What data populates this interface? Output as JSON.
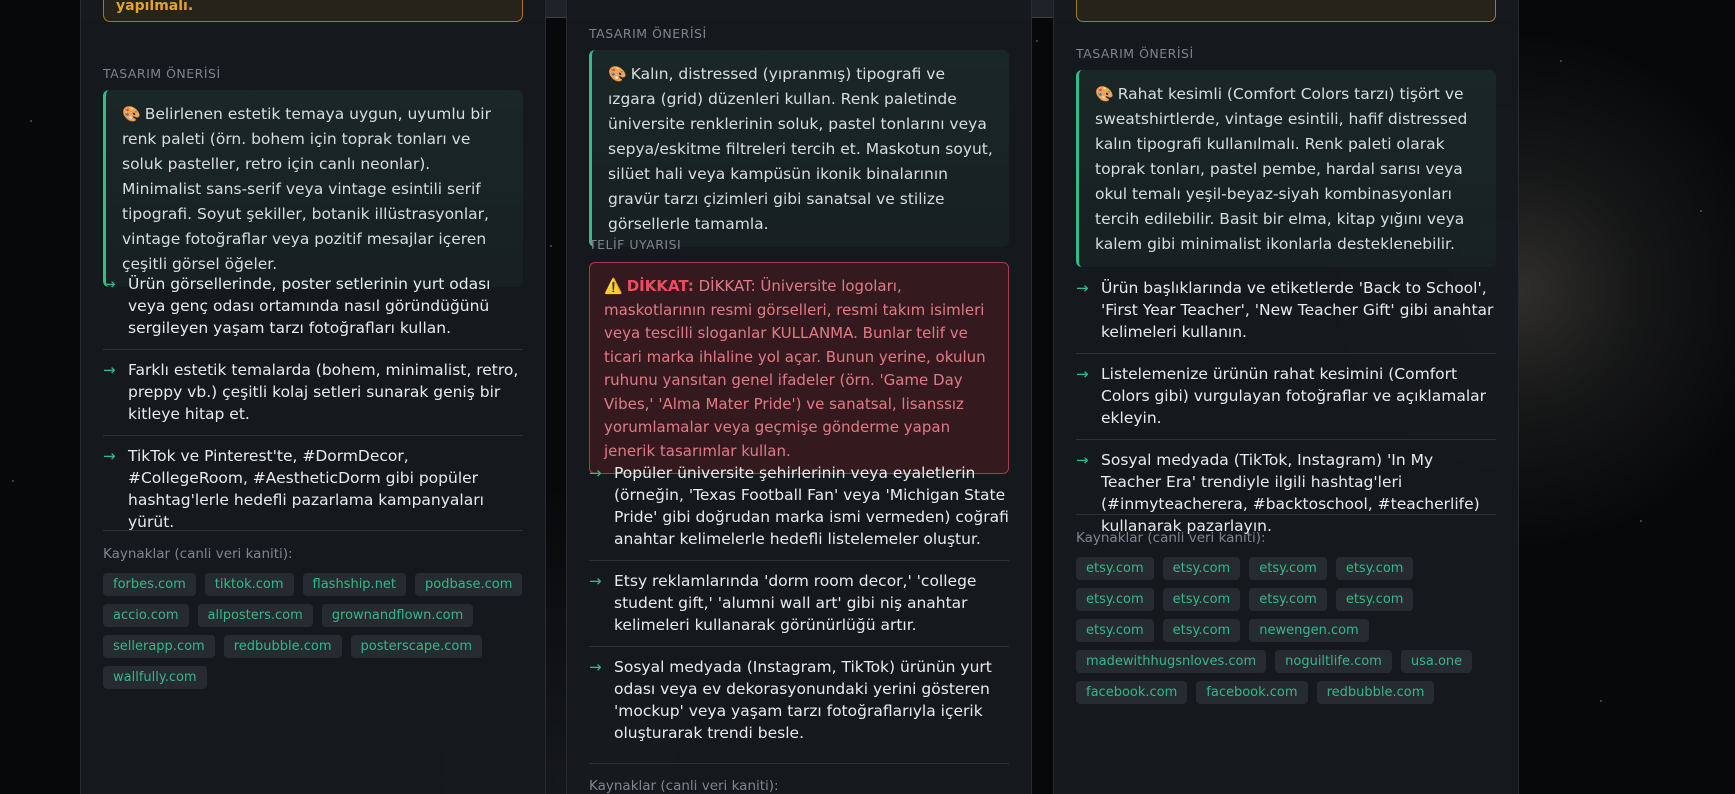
{
  "columns": [
    {
      "warning_tail": "yapılmalı.",
      "design_label": "TASARIM ÖNERİSİ",
      "design_emoji": "🎨",
      "design_text": "Belirlenen estetik temaya uygun, uyumlu bir renk paleti (örn. bohem için toprak tonları ve soluk pasteller, retro için canlı neonlar). Minimalist sans-serif veya vintage esintili serif tipografi. Soyut şekiller, botanik illüstrasyonlar, vintage fotoğraflar veya pozitif mesajlar içeren çeşitli görsel öğeler.",
      "bullets": [
        "Ürün görsellerinde, poster setlerinin yurt odası veya genç odası ortamında nasıl göründüğünü sergileyen yaşam tarzı fotoğrafları kullan.",
        "Farklı estetik temalarda (bohem, minimalist, retro, preppy vb.) çeşitli kolaj setleri sunarak geniş bir kitleye hitap et.",
        "TikTok ve Pinterest'te, #DormDecor, #CollegeRoom, #AestheticDorm gibi popüler hashtag'lerle hedefli pazarlama kampanyaları yürüt."
      ],
      "sources_label": "Kaynaklar (canli veri kaniti):",
      "sources": [
        "forbes.com",
        "tiktok.com",
        "flashship.net",
        "podbase.com",
        "accio.com",
        "allposters.com",
        "grownandflown.com",
        "sellerapp.com",
        "redbubble.com",
        "posterscape.com",
        "wallfully.com"
      ]
    },
    {
      "design_label": "TASARIM ÖNERİSİ",
      "design_emoji": "🎨",
      "design_text": "Kalın, distressed (yıpranmış) tipografi ve ızgara (grid) düzenleri kullan. Renk paletinde üniversite renklerinin soluk, pastel tonlarını veya sepya/eskitme filtreleri tercih et. Maskotun soyut, silüet hali veya kampüsün ikonik binalarının gravür tarzı çizimleri gibi sanatsal ve stilize görsellerle tamamla.",
      "copyright_label": "TELİF UYARISI",
      "copyright_emoji": "⚠️",
      "copyright_title": "DİKKAT:",
      "copyright_text": "DİKKAT: Üniversite logoları, maskotlarının resmi görselleri, resmi takım isimleri veya tescilli sloganlar KULLANMA. Bunlar telif ve ticari marka ihlaline yol açar. Bunun yerine, okulun ruhunu yansıtan genel ifadeler (örn. 'Game Day Vibes,' 'Alma Mater Pride') ve sanatsal, lisanssız yorumlamalar veya geçmişe gönderme yapan jenerik tasarımlar kullan.",
      "bullets": [
        "Popüler üniversite şehirlerinin veya eyaletlerin (örneğin, 'Texas Football Fan' veya 'Michigan State Pride' gibi doğrudan marka ismi vermeden) coğrafi anahtar kelimelerle hedefli listelemeler oluştur.",
        "Etsy reklamlarında 'dorm room decor,' 'college student gift,' 'alumni wall art' gibi niş anahtar kelimeleri kullanarak görünürlüğü artır.",
        "Sosyal medyada (Instagram, TikTok) ürünün yurt odası veya ev dekorasyonundaki yerini gösteren 'mockup' veya yaşam tarzı fotoğraflarıyla içerik oluşturarak trendi besle."
      ],
      "sources_label": "Kaynaklar (canli veri kaniti):"
    },
    {
      "design_label": "TASARIM ÖNERİSİ",
      "design_emoji": "🎨",
      "design_text": "Rahat kesimli (Comfort Colors tarzı) tişört ve sweatshirtlerde, vintage esintili, hafif distressed kalın tipografi kullanılmalı. Renk paleti olarak toprak tonları, pastel pembe, hardal sarısı veya okul temalı yeşil-beyaz-siyah kombinasyonları tercih edilebilir. Basit bir elma, kitap yığını veya kalem gibi minimalist ikonlarla desteklenebilir.",
      "bullets": [
        "Ürün başlıklarında ve etiketlerde 'Back to School', 'First Year Teacher', 'New Teacher Gift' gibi anahtar kelimeleri kullanın.",
        "Listelemenize ürünün rahat kesimini (Comfort Colors gibi) vurgulayan fotoğraflar ve açıklamalar ekleyin.",
        "Sosyal medyada (TikTok, Instagram) 'In My Teacher Era' trendiyle ilgili hashtag'leri (#inmyteacherera, #backtoschool, #teacherlife) kullanarak pazarlayın."
      ],
      "sources_label": "Kaynaklar (canli veri kaniti):",
      "sources": [
        "etsy.com",
        "etsy.com",
        "etsy.com",
        "etsy.com",
        "etsy.com",
        "etsy.com",
        "etsy.com",
        "etsy.com",
        "etsy.com",
        "etsy.com",
        "newengen.com",
        "madewithhugsnloves.com",
        "noguiltlife.com",
        "usa.one",
        "facebook.com",
        "facebook.com",
        "redbubble.com"
      ]
    }
  ]
}
